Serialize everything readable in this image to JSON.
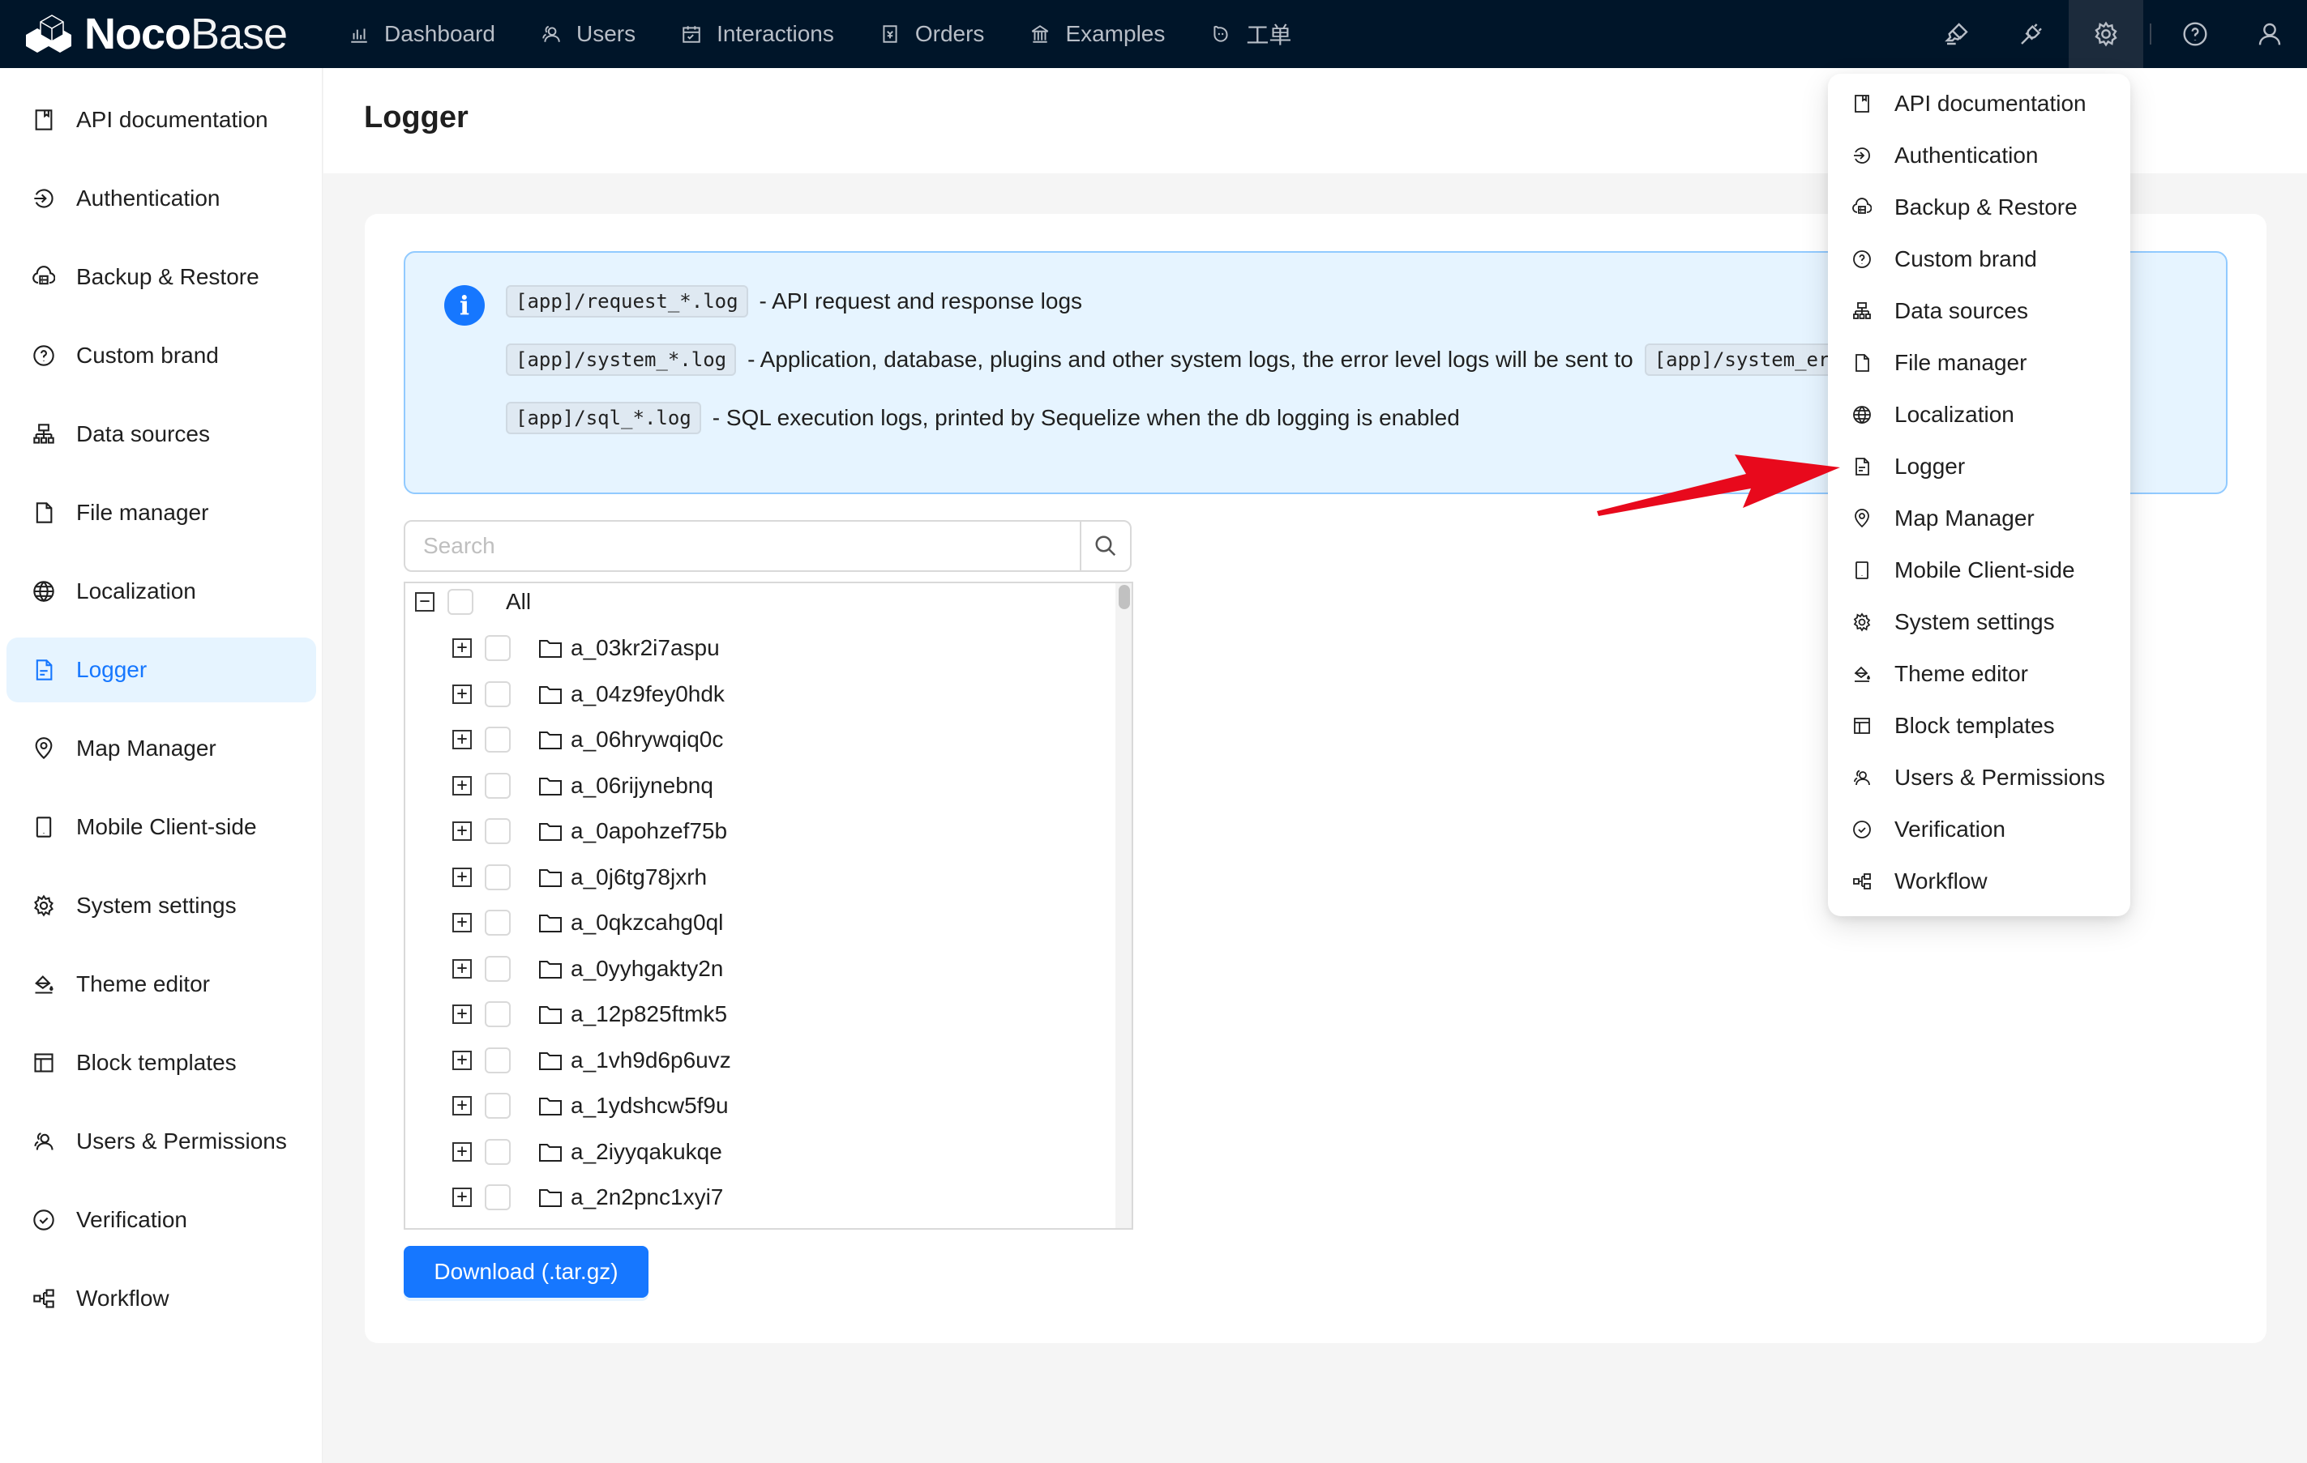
{
  "app": {
    "logo_bold": "Noco",
    "logo_light": "Base"
  },
  "topnav": [
    {
      "label": "Dashboard",
      "icon": "bar-chart-icon"
    },
    {
      "label": "Users",
      "icon": "users-icon"
    },
    {
      "label": "Interactions",
      "icon": "calendar-check-icon"
    },
    {
      "label": "Orders",
      "icon": "receipt-icon"
    },
    {
      "label": "Examples",
      "icon": "bank-icon"
    },
    {
      "label": "工单",
      "icon": "ghost-icon"
    }
  ],
  "top_right_icons": [
    "highlighter-icon",
    "plugin-icon",
    "settings-icon",
    "help-icon",
    "user-icon"
  ],
  "sidebar": {
    "active_index": 7,
    "items": [
      {
        "label": "API documentation",
        "icon": "book-icon"
      },
      {
        "label": "Authentication",
        "icon": "login-icon"
      },
      {
        "label": "Backup & Restore",
        "icon": "cloud-server-icon"
      },
      {
        "label": "Custom brand",
        "icon": "question-circle-icon"
      },
      {
        "label": "Data sources",
        "icon": "cluster-icon"
      },
      {
        "label": "File manager",
        "icon": "file-icon"
      },
      {
        "label": "Localization",
        "icon": "globe-icon"
      },
      {
        "label": "Logger",
        "icon": "file-text-icon"
      },
      {
        "label": "Map Manager",
        "icon": "map-pin-icon"
      },
      {
        "label": "Mobile Client-side",
        "icon": "mobile-icon"
      },
      {
        "label": "System settings",
        "icon": "gear-icon"
      },
      {
        "label": "Theme editor",
        "icon": "paint-bucket-icon"
      },
      {
        "label": "Block templates",
        "icon": "layout-icon"
      },
      {
        "label": "Users & Permissions",
        "icon": "users-icon"
      },
      {
        "label": "Verification",
        "icon": "check-circle-icon"
      },
      {
        "label": "Workflow",
        "icon": "workflow-icon"
      }
    ]
  },
  "page": {
    "title": "Logger"
  },
  "alert": {
    "lines": [
      {
        "code": "[app]/request_*.log",
        "text": "- API request and response logs"
      },
      {
        "code": "[app]/system_*.log",
        "text": "- Application, database, plugins and other system logs, the error level logs will be sent to",
        "trailing_code": "[app]/system_error_*.log"
      },
      {
        "code": "[app]/sql_*.log",
        "text": "- SQL execution logs, printed by Sequelize when the db logging is enabled"
      }
    ]
  },
  "search": {
    "placeholder": "Search",
    "value": ""
  },
  "tree": {
    "root_label": "All",
    "items": [
      "a_03kr2i7aspu",
      "a_04z9fey0hdk",
      "a_06hrywqiq0c",
      "a_06rijynebnq",
      "a_0apohzef75b",
      "a_0j6tg78jxrh",
      "a_0qkzcahg0ql",
      "a_0yyhgakty2n",
      "a_12p825ftmk5",
      "a_1vh9d6p6uvz",
      "a_1ydshcw5f9u",
      "a_2iyyqakukqe",
      "a_2n2pnc1xyi7"
    ]
  },
  "download_button": "Download (.tar.gz)",
  "dropdown": {
    "items": [
      {
        "label": "API documentation",
        "icon": "book-icon"
      },
      {
        "label": "Authentication",
        "icon": "login-icon"
      },
      {
        "label": "Backup & Restore",
        "icon": "cloud-server-icon"
      },
      {
        "label": "Custom brand",
        "icon": "question-circle-icon"
      },
      {
        "label": "Data sources",
        "icon": "cluster-icon"
      },
      {
        "label": "File manager",
        "icon": "file-icon"
      },
      {
        "label": "Localization",
        "icon": "globe-icon"
      },
      {
        "label": "Logger",
        "icon": "file-text-icon"
      },
      {
        "label": "Map Manager",
        "icon": "map-pin-icon"
      },
      {
        "label": "Mobile Client-side",
        "icon": "mobile-icon"
      },
      {
        "label": "System settings",
        "icon": "gear-icon"
      },
      {
        "label": "Theme editor",
        "icon": "paint-bucket-icon"
      },
      {
        "label": "Block templates",
        "icon": "layout-icon"
      },
      {
        "label": "Users & Permissions",
        "icon": "users-icon"
      },
      {
        "label": "Verification",
        "icon": "check-circle-icon"
      },
      {
        "label": "Workflow",
        "icon": "workflow-icon"
      }
    ]
  },
  "colors": {
    "topbar": "#001529",
    "accent": "#1677ff",
    "active_bg": "#e6f4ff",
    "alert_border": "#91caff",
    "annotation_arrow": "#e8091c"
  }
}
